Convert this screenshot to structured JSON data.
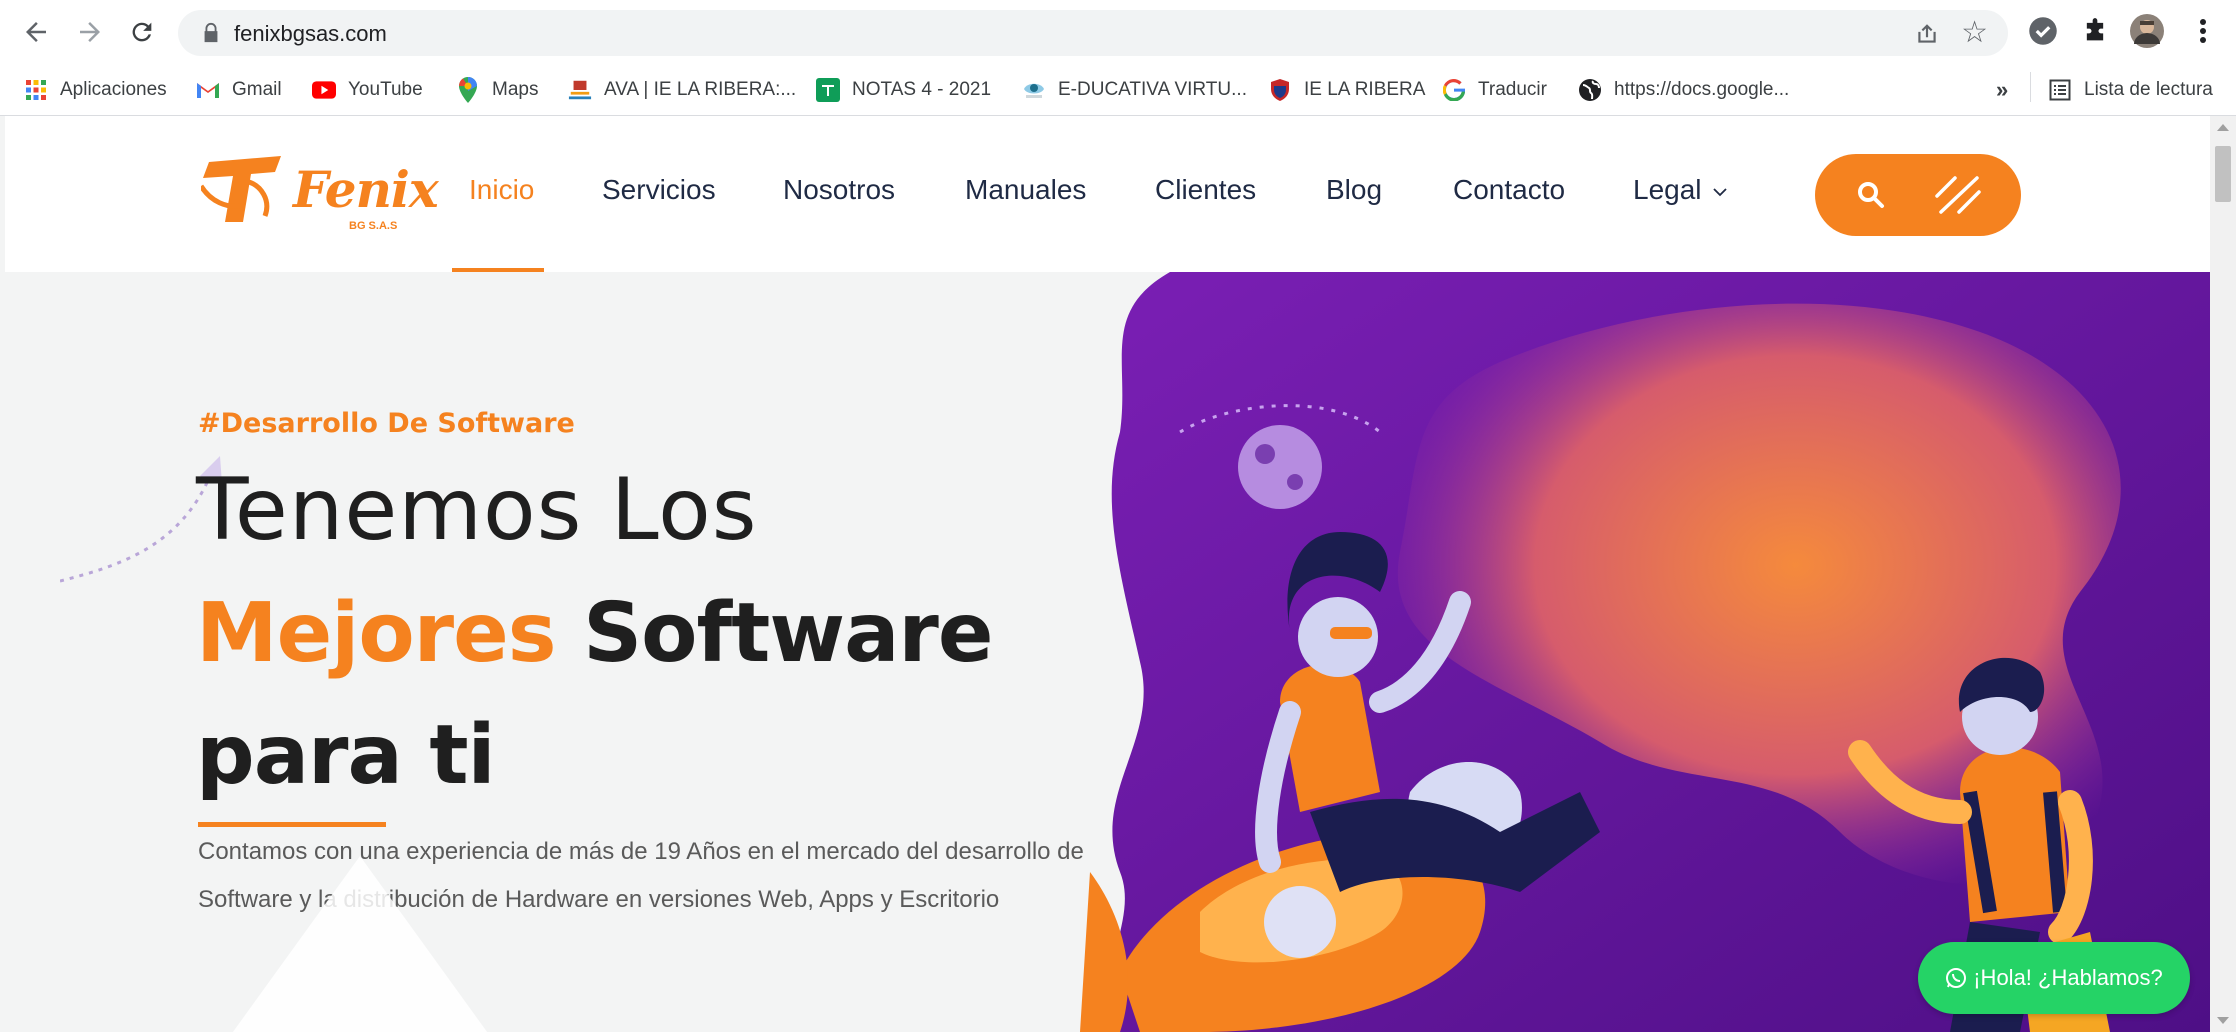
{
  "browser": {
    "url": "fenixbgsas.com",
    "bookmarks": [
      {
        "label": "Aplicaciones",
        "icon": "apps-grid-icon"
      },
      {
        "label": "Gmail",
        "icon": "gmail-icon"
      },
      {
        "label": "YouTube",
        "icon": "youtube-icon"
      },
      {
        "label": "Maps",
        "icon": "maps-pin-icon"
      },
      {
        "label": "AVA | IE LA RIBERA:...",
        "icon": "ava-icon"
      },
      {
        "label": "NOTAS 4 - 2021",
        "icon": "sheets-icon"
      },
      {
        "label": "E-DUCATIVA VIRTU...",
        "icon": "educativa-icon"
      },
      {
        "label": "IE LA RIBERA",
        "icon": "shield-icon"
      },
      {
        "label": "Traducir",
        "icon": "google-icon"
      },
      {
        "label": "https://docs.google...",
        "icon": "globe-icon"
      }
    ],
    "more_bookmarks": "»",
    "reading_list": "Lista de lectura"
  },
  "site": {
    "logo": {
      "brand": "Fenix",
      "sub": "BG S.A.S"
    },
    "menu": [
      {
        "label": "Inicio",
        "active": true
      },
      {
        "label": "Servicios",
        "active": false
      },
      {
        "label": "Nosotros",
        "active": false
      },
      {
        "label": "Manuales",
        "active": false
      },
      {
        "label": "Clientes",
        "active": false
      },
      {
        "label": "Blog",
        "active": false
      },
      {
        "label": "Contacto",
        "active": false
      },
      {
        "label": "Legal",
        "active": false
      }
    ],
    "colors": {
      "accent": "#f5821f",
      "purple": "#6a16a8",
      "whatsapp": "#25d366"
    }
  },
  "hero": {
    "tag": "#Desarrollo De Software",
    "line1": "Tenemos Los",
    "line2_accent": "Mejores",
    "line2_rest": " Software",
    "line3": "para ti",
    "description": "Contamos con una experiencia de más de 19 Años en el mercado del desarrollo de Software y la distribución de Hardware en versiones Web, Apps y Escritorio"
  },
  "chat_button": "¡Hola! ¿Hablamos?"
}
